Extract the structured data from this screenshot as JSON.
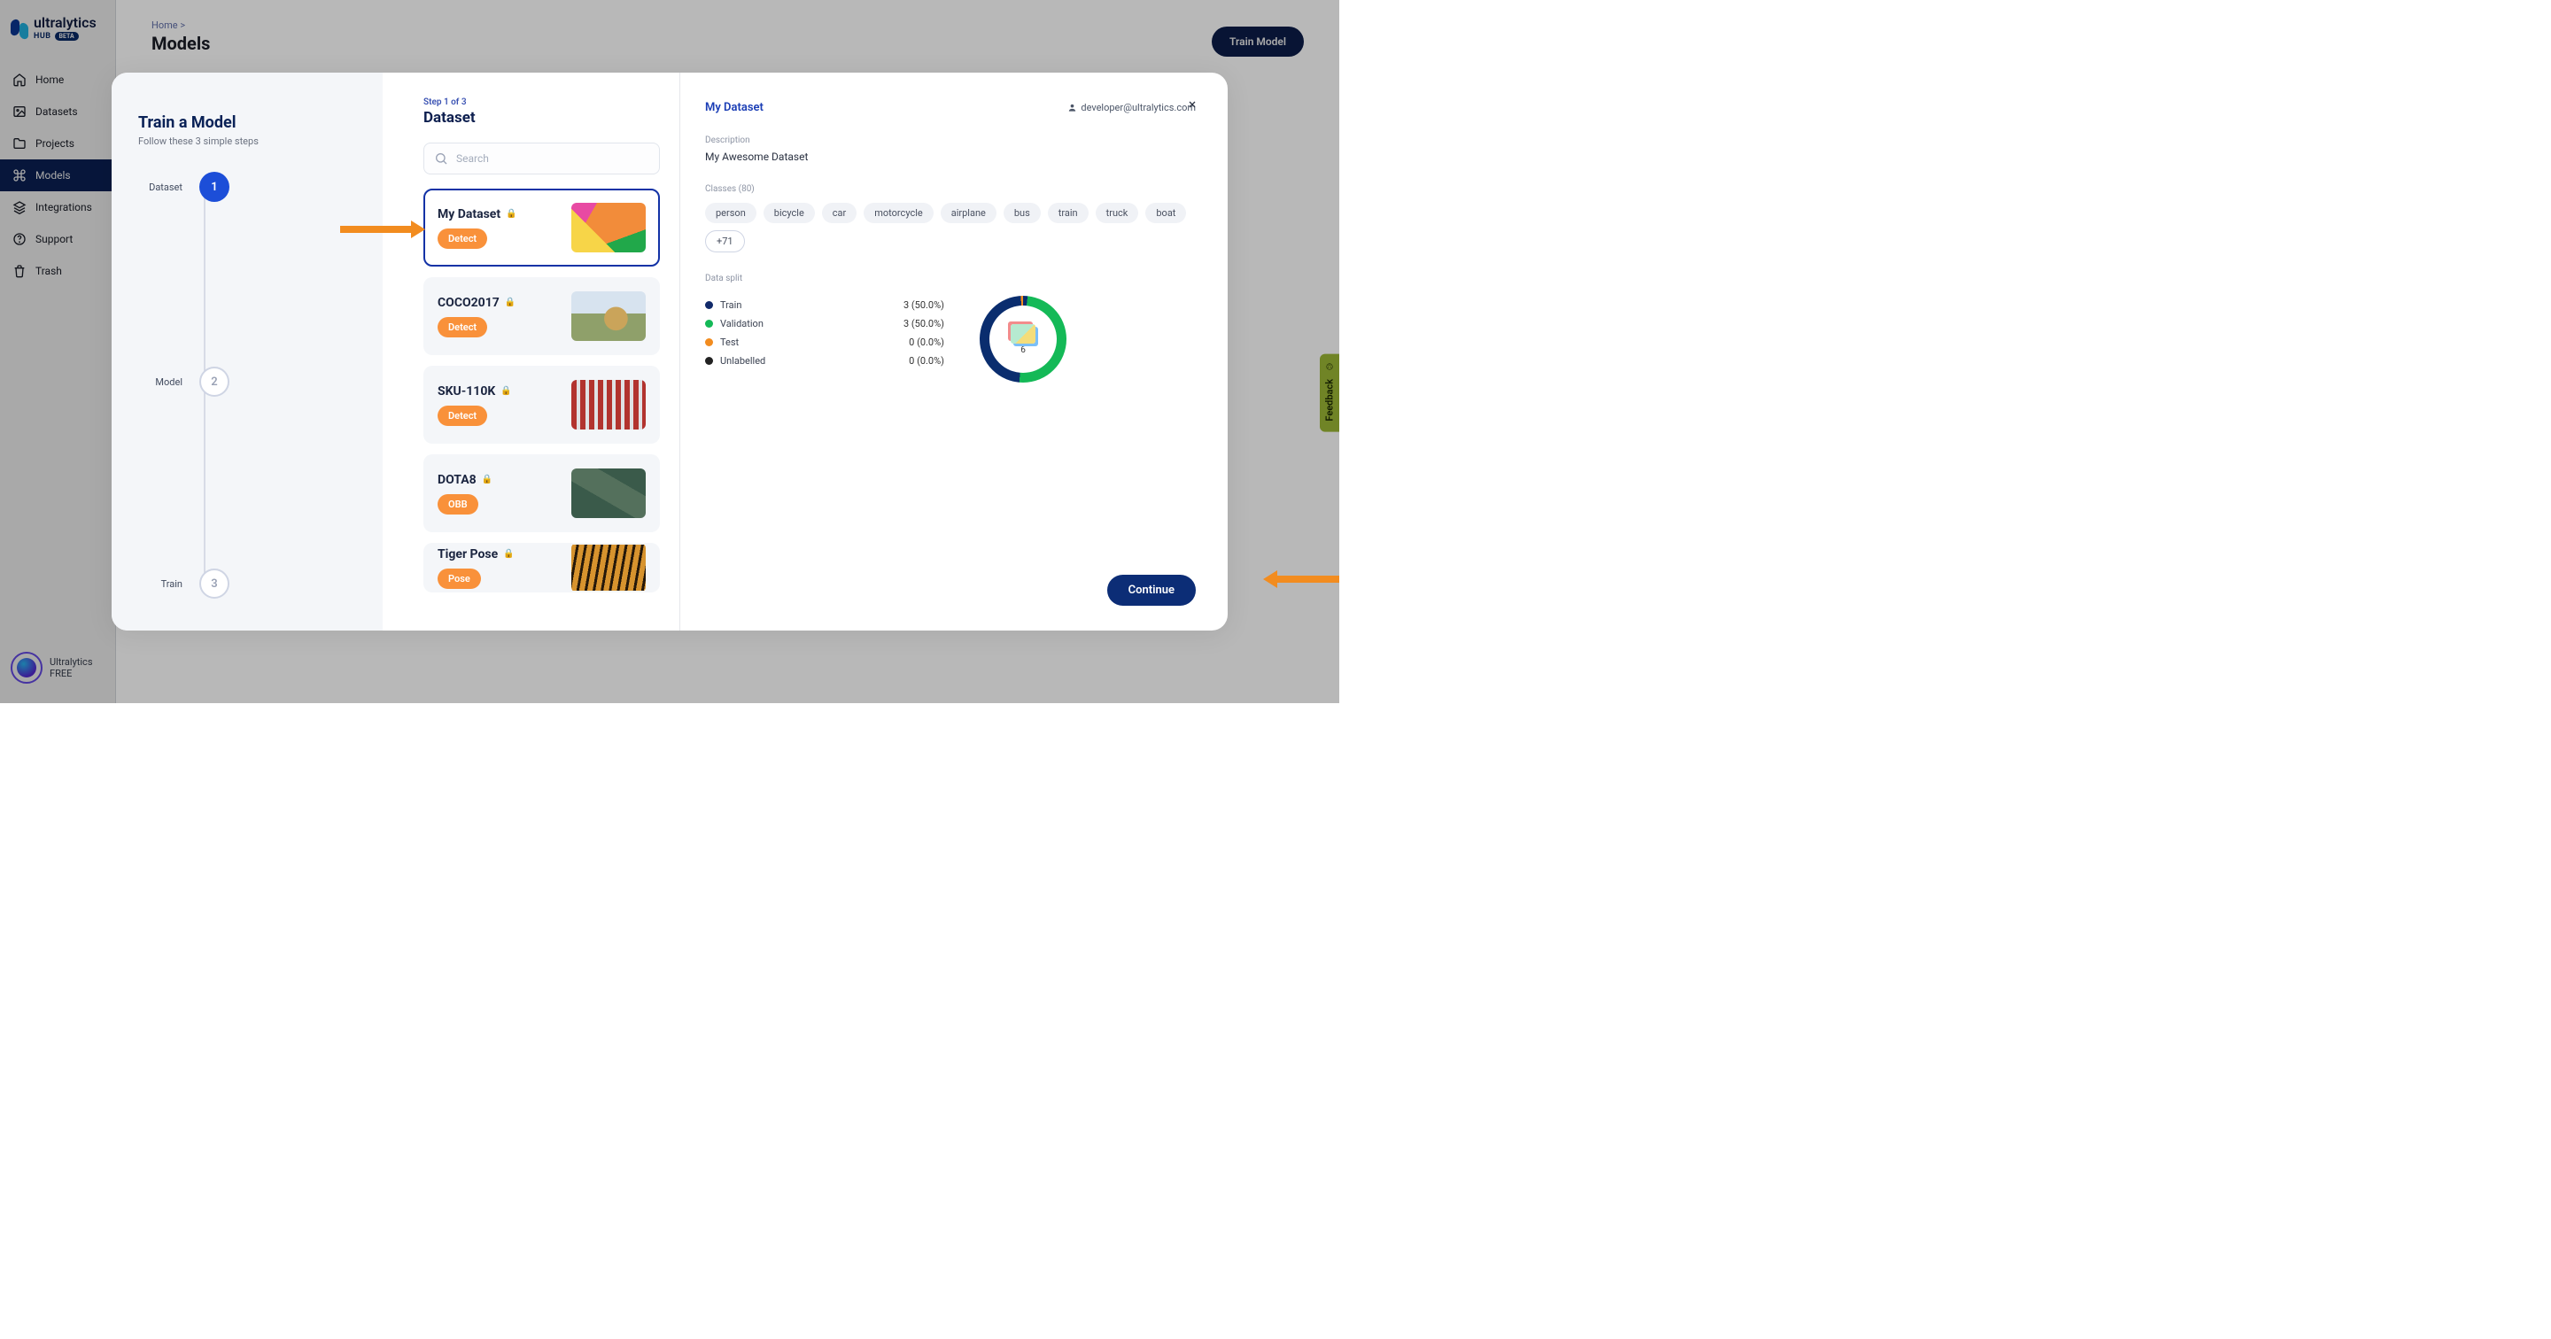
{
  "logo": {
    "brand": "ultralytics",
    "hub": "HUB",
    "beta": "BETA"
  },
  "nav": {
    "home": "Home",
    "datasets": "Datasets",
    "projects": "Projects",
    "models": "Models",
    "integrations": "Integrations",
    "support": "Support",
    "trash": "Trash"
  },
  "user": {
    "name": "Ultralytics",
    "plan": "FREE"
  },
  "breadcrumb": {
    "home": "Home",
    "sep": ">"
  },
  "page": {
    "title": "Models",
    "train_btn": "Train Model"
  },
  "feedback": "Feedback",
  "modal": {
    "title": "Train a Model",
    "subtitle": "Follow these 3 simple steps",
    "step_indicator": "Step 1 of 3",
    "panel_title": "Dataset",
    "steps": [
      {
        "label": "Dataset",
        "num": "1"
      },
      {
        "label": "Model",
        "num": "2"
      },
      {
        "label": "Train",
        "num": "3"
      }
    ],
    "search_placeholder": "Search",
    "continue": "Continue"
  },
  "datasets": [
    {
      "name": "My Dataset",
      "tag": "Detect"
    },
    {
      "name": "COCO2017",
      "tag": "Detect"
    },
    {
      "name": "SKU-110K",
      "tag": "Detect"
    },
    {
      "name": "DOTA8",
      "tag": "OBB"
    },
    {
      "name": "Tiger Pose",
      "tag": "Pose"
    }
  ],
  "detail": {
    "name": "My Dataset",
    "email": "developer@ultralytics.com",
    "desc_label": "Description",
    "description": "My Awesome Dataset",
    "classes_label": "Classes (80)",
    "classes": [
      "person",
      "bicycle",
      "car",
      "motorcycle",
      "airplane",
      "bus",
      "train",
      "truck",
      "boat"
    ],
    "classes_more": "+71",
    "split_label": "Data split",
    "split": [
      {
        "name": "Train",
        "value": "3 (50.0%)",
        "color": "navy"
      },
      {
        "name": "Validation",
        "value": "3 (50.0%)",
        "color": "green"
      },
      {
        "name": "Test",
        "value": "0 (0.0%)",
        "color": "orange"
      },
      {
        "name": "Unlabelled",
        "value": "0 (0.0%)",
        "color": "black"
      }
    ],
    "donut_count": "6"
  }
}
